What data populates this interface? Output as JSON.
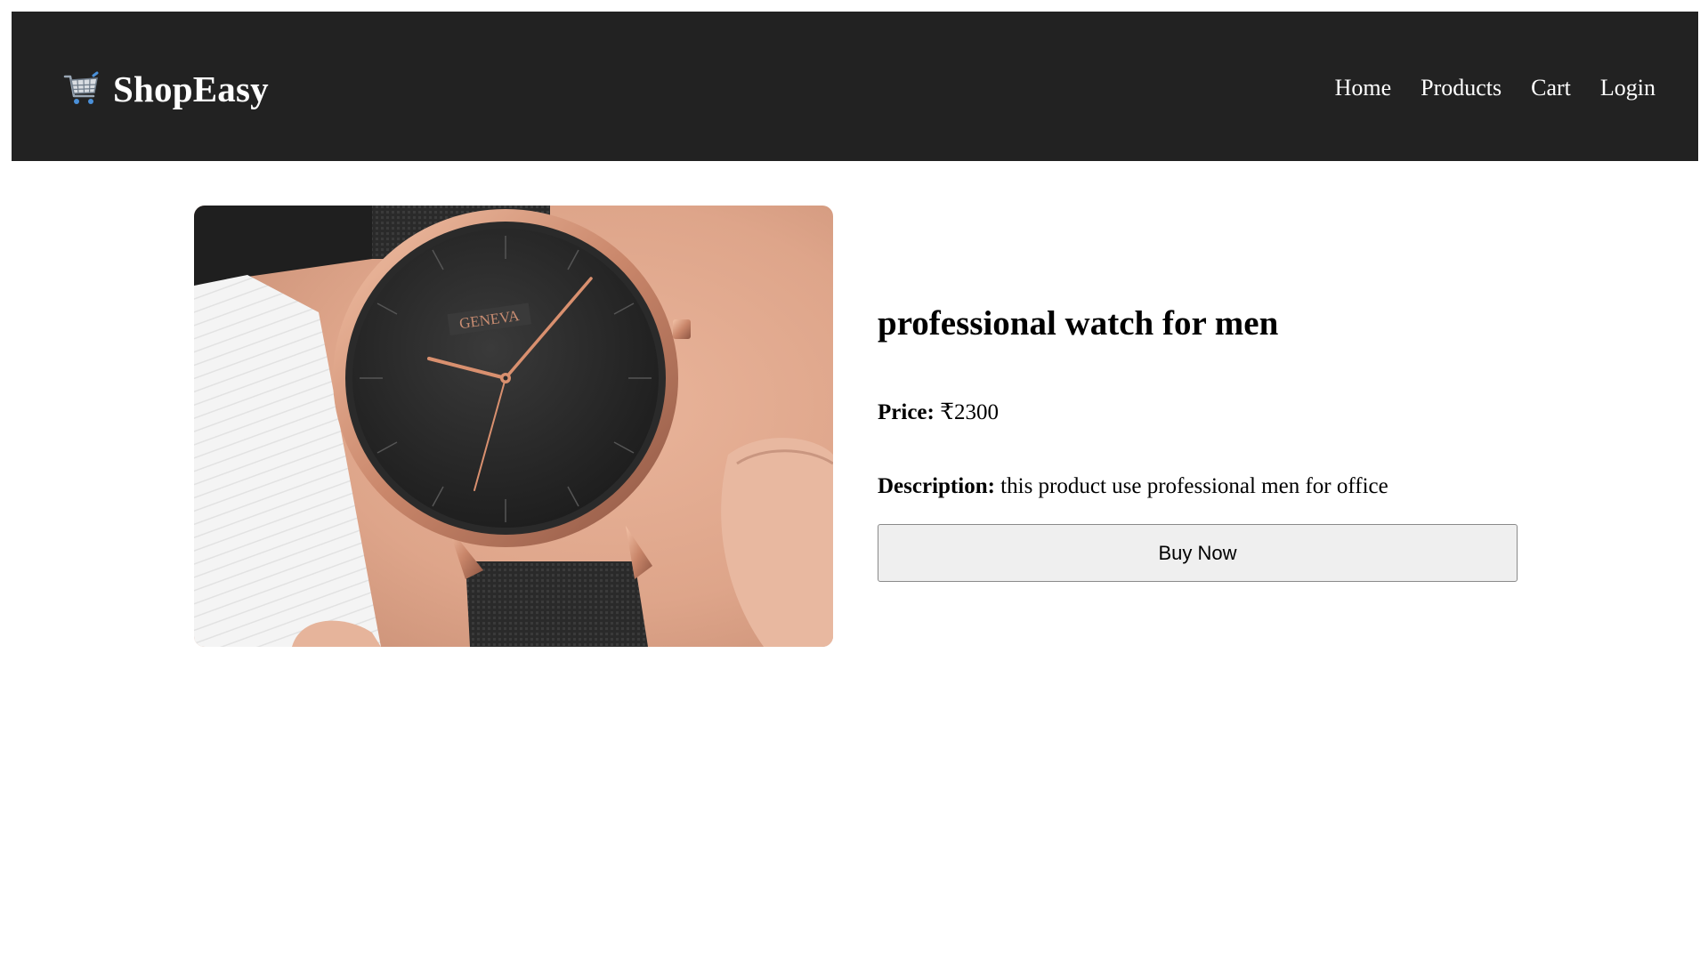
{
  "header": {
    "brand_name": "ShopEasy",
    "brand_icon": "shopping-cart-icon",
    "nav": [
      "Home",
      "Products",
      "Cart",
      "Login"
    ]
  },
  "product": {
    "title": "professional watch for men",
    "price_label": "Price:",
    "price_value": "₹2300",
    "description_label": "Description:",
    "description_value": "this product use professional men for office",
    "buy_label": "Buy Now",
    "watch_brand": "GENEVA"
  },
  "colors": {
    "navbar_bg": "#222222",
    "nav_text": "#ffffff",
    "button_bg": "#efefef"
  }
}
